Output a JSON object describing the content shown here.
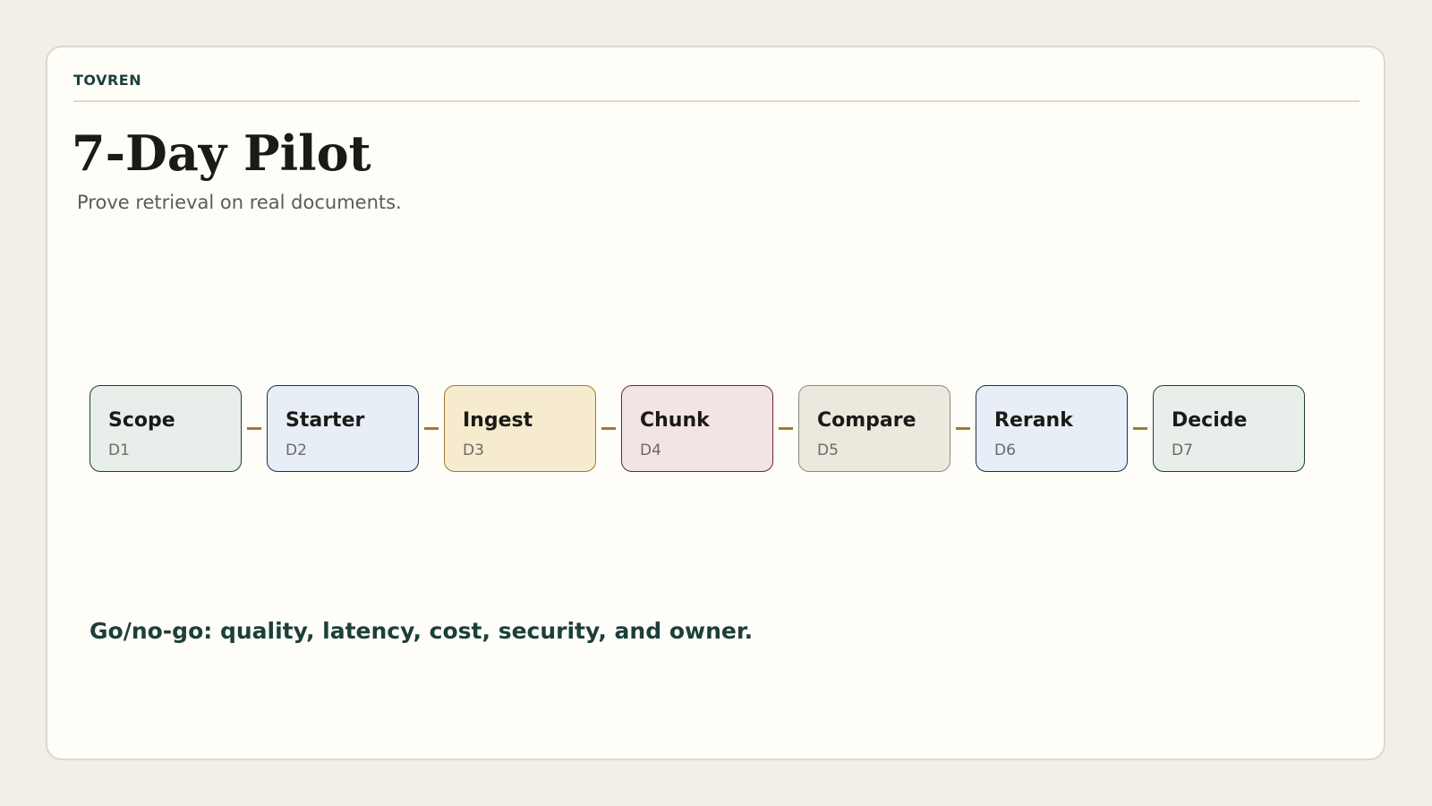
{
  "brand": "TOVREN",
  "title": "7-Day Pilot",
  "subtitle": "Prove retrieval on real documents.",
  "steps": [
    {
      "label": "Scope",
      "day": "D1",
      "fill": "#e8efea",
      "border": "#1c3f3a"
    },
    {
      "label": "Starter",
      "day": "D2",
      "fill": "#e8eef6",
      "border": "#1e2f4a"
    },
    {
      "label": "Ingest",
      "day": "D3",
      "fill": "#f6eacf",
      "border": "#a07a2a"
    },
    {
      "label": "Chunk",
      "day": "D4",
      "fill": "#f3e4e4",
      "border": "#6b2335"
    },
    {
      "label": "Compare",
      "day": "D5",
      "fill": "#ece8de",
      "border": "#8a8a82"
    },
    {
      "label": "Rerank",
      "day": "D6",
      "fill": "#e8eef6",
      "border": "#1e2f4a"
    },
    {
      "label": "Decide",
      "day": "D7",
      "fill": "#e8efea",
      "border": "#1c3f3a"
    }
  ],
  "connector_color": "#a07a2a",
  "footer": "Go/no-go: quality, latency, cost, security, and owner."
}
